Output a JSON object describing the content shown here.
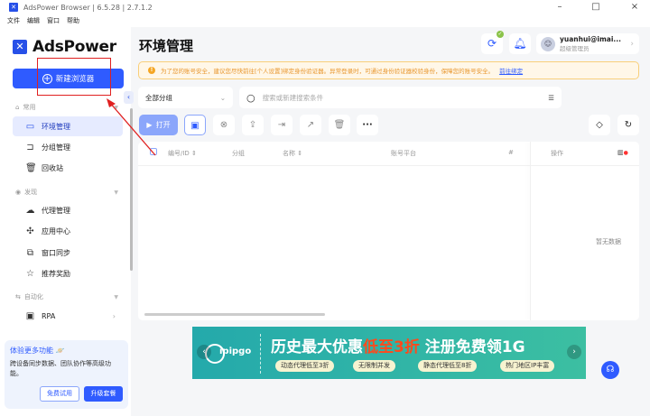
{
  "window": {
    "title": "AdsPower Browser | 6.5.28 | 2.7.1.2",
    "minimize": "–",
    "maximize": "□",
    "close": "×"
  },
  "menu": [
    "文件",
    "编辑",
    "窗口",
    "帮助"
  ],
  "brand": "AdsPower",
  "new_browser": "新建浏览器",
  "sidebar": {
    "sections": [
      {
        "label": "常用"
      },
      {
        "label": "发现"
      },
      {
        "label": "自动化"
      }
    ],
    "items": [
      {
        "label": "环境管理"
      },
      {
        "label": "分组管理"
      },
      {
        "label": "回收站"
      },
      {
        "label": "代理管理"
      },
      {
        "label": "应用中心"
      },
      {
        "label": "窗口同步"
      },
      {
        "label": "推荐奖励"
      },
      {
        "label": "RPA"
      }
    ],
    "promo": {
      "title": "体验更多功能",
      "desc": "跨设备同步数据、团队协作等高级功能。",
      "trial": "免费试用",
      "upgrade": "升级套餐"
    }
  },
  "header": {
    "title": "环境管理",
    "user": {
      "name": "yuanhui@imai...",
      "role": "超级管理员"
    }
  },
  "alert": {
    "text": "为了您的账号安全，建议您尽快前往[个人设置]绑定身份验证器。异常登录时，可通过身份验证器校验身份，保障您的账号安全。",
    "link": "前往绑定"
  },
  "filters": {
    "group": "全部分组",
    "search_placeholder": "搜索或新建搜索条件"
  },
  "toolbar": {
    "open": "打开"
  },
  "table": {
    "columns": [
      "编号/ID",
      "分组",
      "名称",
      "账号平台",
      "#",
      "操作"
    ],
    "empty": "暂无数据"
  },
  "banner": {
    "logo": "ipipgo",
    "headline_a": "历史最大优惠",
    "headline_b": "低至3折",
    "headline_c": " 注册免费领1G",
    "pills": [
      "动态代理低至3折",
      "无限制并发",
      "静态代理低至8折",
      "热门地区IP丰富"
    ]
  },
  "colors": {
    "accent": "#2f5bff",
    "annotation": "#e02020"
  }
}
